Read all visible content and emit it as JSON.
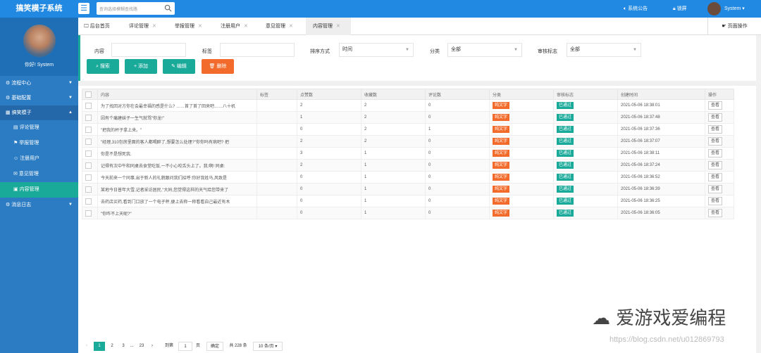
{
  "app": {
    "title": "搞笑模子系统"
  },
  "header": {
    "search_placeholder": "查询选择模糊查找路",
    "notice": "系统公告",
    "lock": "锁屏",
    "user": "System"
  },
  "sidebar": {
    "greeting": "你好! System",
    "groups": [
      {
        "label": "流程中心"
      },
      {
        "label": "基础配置"
      },
      {
        "label": "搞笑模子"
      }
    ],
    "subitems": [
      "评论管理",
      "举报管理",
      "注册用户",
      "意见管理",
      "内容管理"
    ],
    "footer_group": "消息日志"
  },
  "tabs": [
    "后台首页",
    "评论管理",
    "举报管理",
    "注册用户",
    "意见管理",
    "内容管理"
  ],
  "page_op": "页面操作",
  "filters": {
    "content_label": "内容",
    "tag_label": "标签",
    "sort_label": "排序方式",
    "sort_value": "时间",
    "category_label": "分类",
    "category_value": "全部",
    "audit_label": "审核标志",
    "audit_value": "全部"
  },
  "buttons": {
    "search": "搜索",
    "add": "添加",
    "edit": "编辑",
    "delete": "删除"
  },
  "table": {
    "headers": [
      "内容",
      "标签",
      "点赞数",
      "收藏数",
      "评论数",
      "分类",
      "审核标志",
      "创建时间",
      "操作"
    ],
    "rows": [
      {
        "content": "为了找回对方你在会最幸福的感是什么? ……首了首了回来吧……八十机",
        "likes": "2",
        "fav": "2",
        "comments": "0",
        "time": "2021-05-06 18:38:01"
      },
      {
        "content": "因有个痛建妹子一生气就骂\"你龙!\"",
        "likes": "1",
        "fav": "2",
        "comments": "0",
        "time": "2021-05-06 18:37:48"
      },
      {
        "content": "\"把我的杯子拿上来。\"",
        "likes": "0",
        "fav": "2",
        "comments": "1",
        "time": "2021-05-06 18:37:36"
      },
      {
        "content": "\"经理,310包房里面的客人都喝醉了,想要怎么处理?\"你你吗有病吧? 把",
        "likes": "2",
        "fav": "2",
        "comments": "0",
        "time": "2021-05-06 18:37:07"
      },
      {
        "content": "你是不是想死我.",
        "likes": "3",
        "fav": "1",
        "comments": "0",
        "time": "2021-05-06 18:38:11"
      },
      {
        "content": "记得有次中午和同桌去食堂吃饭,一不小心咬舌头上了。我:啊! 同桌:",
        "likes": "2",
        "fav": "1",
        "comments": "0",
        "time": "2021-05-06 18:37:24"
      },
      {
        "content": "今天前来一个同事,出于新人的礼貌跟问我们招呼:你好我姓马,风致是",
        "likes": "0",
        "fav": "1",
        "comments": "0",
        "time": "2021-05-06 18:36:52"
      },
      {
        "content": "某地今日普年大雪,记者采访居民,\"大妈,您觉得这样的天气给您带来了",
        "likes": "0",
        "fav": "1",
        "comments": "0",
        "time": "2021-05-06 18:36:39"
      },
      {
        "content": "去药店买药,看到门口放了一个电子秤,便上去称一称看看自己最近有木",
        "likes": "0",
        "fav": "1",
        "comments": "0",
        "time": "2021-05-06 18:36:25"
      },
      {
        "content": "\"你咋不上天呢?\"",
        "likes": "0",
        "fav": "1",
        "comments": "0",
        "time": "2021-05-06 18:36:05"
      }
    ],
    "category_tag": "纯文字",
    "audit_tag": "已通过",
    "view_label": "查看"
  },
  "pager": {
    "pages": [
      "1",
      "2",
      "3",
      "...",
      "23"
    ],
    "goto_label": "到第",
    "goto_value": "1",
    "page_unit": "页",
    "confirm": "确定",
    "total": "共 228 条",
    "per_page": "10 条/页"
  },
  "watermark": "爱游戏爱编程",
  "watermark_url": "https://blog.csdn.net/u012869793"
}
